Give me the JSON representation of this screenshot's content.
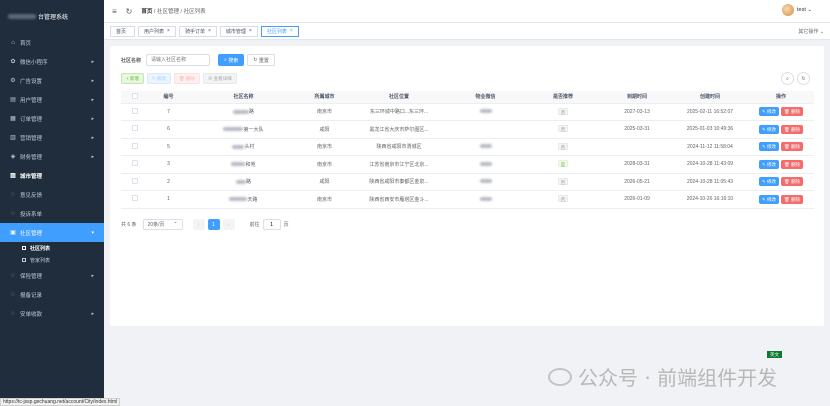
{
  "sidebar": {
    "logo_text": "台管理系统",
    "items": [
      {
        "icon": "⌂",
        "label": "首页",
        "arrow": ""
      },
      {
        "icon": "✿",
        "label": "微信小程序",
        "arrow": "▸"
      },
      {
        "icon": "⚙",
        "label": "广告设置",
        "arrow": "▸"
      },
      {
        "icon": "▤",
        "label": "用户管理",
        "arrow": "▸"
      },
      {
        "icon": "▦",
        "label": "订单管理",
        "arrow": "▸"
      },
      {
        "icon": "▥",
        "label": "营销管理",
        "arrow": "▸"
      },
      {
        "icon": "◈",
        "label": "财务管理",
        "arrow": "▸"
      },
      {
        "icon": "▨",
        "label": "城市管理",
        "arrow": ""
      },
      {
        "icon": "◌",
        "label": "意见反馈",
        "arrow": ""
      },
      {
        "icon": "◌",
        "label": "投诉系单",
        "arrow": ""
      },
      {
        "icon": "▣",
        "label": "社区管理",
        "arrow": "▾"
      },
      {
        "icon": "◌",
        "label": "保险管理",
        "arrow": "▸"
      },
      {
        "icon": "◌",
        "label": "报备记录",
        "arrow": ""
      },
      {
        "icon": "◌",
        "label": "安单收款",
        "arrow": "▸"
      }
    ],
    "sub_items": [
      {
        "label": "社区列表"
      },
      {
        "label": "管家列表"
      }
    ]
  },
  "navbar": {
    "crumbs": [
      "首页",
      "社区管理",
      "社区列表"
    ],
    "user_name": "test"
  },
  "tags": [
    {
      "label": "首页",
      "close": ""
    },
    {
      "label": "用户列表",
      "close": "×"
    },
    {
      "label": "骑手订单",
      "close": "×"
    },
    {
      "label": "城市管理",
      "close": "×"
    },
    {
      "label": "社区列表",
      "close": "×"
    }
  ],
  "other_ops": "其它操作 ⌄",
  "search": {
    "label": "社区名称",
    "placeholder": "请输入社区名称",
    "search_btn": "搜索",
    "reset_btn": "重置"
  },
  "toolbar": {
    "add": "+ 新增",
    "edit": "✎ 修改",
    "delete": "🗑 删除",
    "log": "⊕ 查看详细"
  },
  "table": {
    "headers": [
      "编号",
      "社区名称",
      "所属城市",
      "社区位置",
      "物业微信",
      "是否推荐",
      "到期时间",
      "创建时间",
      "操作"
    ],
    "rows": [
      {
        "id": "7",
        "name": "路",
        "city": "南京市",
        "location": "东三环城中路口...东三环...",
        "recommend": "否",
        "expire": "2027-03-13",
        "created": "2025-02-11 16:52:07"
      },
      {
        "id": "6",
        "name": "第一大队",
        "city": "咸阳",
        "location": "黑龙江省大庆市萨尔图区...",
        "recommend": "否",
        "expire": "2025-03-31",
        "created": "2025-01-03 10:49:36"
      },
      {
        "id": "5",
        "name": "头村",
        "city": "南京市",
        "location": "陕西省咸阳市渭城区",
        "recommend": "否",
        "expire": "",
        "created": "2024-11-12 11:58:04"
      },
      {
        "id": "3",
        "name": "和苑",
        "city": "南京市",
        "location": "江苏省南京市江宁区北京...",
        "recommend": "是",
        "expire": "2028-03-31",
        "created": "2024-10-28 11:43:09"
      },
      {
        "id": "2",
        "name": "路",
        "city": "咸阳",
        "location": "陕西省咸阳市秦都区金泉...",
        "recommend": "否",
        "expire": "2026-05-21",
        "created": "2024-10-28 11:05:43"
      },
      {
        "id": "1",
        "name": "天路",
        "city": "南京市",
        "location": "陕西省西安市雁塔区金斗...",
        "recommend": "否",
        "expire": "2026-01-09",
        "created": "2024-10-26 16:16:10"
      }
    ],
    "edit_label": "✎ 修改",
    "delete_label": "🗑 删除"
  },
  "pager": {
    "total": "共 6 条",
    "size": "20条/页",
    "prev": "‹",
    "page": "1",
    "next": "›",
    "goto_label": "前往",
    "goto_value": "1",
    "goto_unit": "页"
  },
  "status_url": "https://tc-jssp.gechuang.net/account/City/index.html",
  "lang_badge": "英文",
  "watermark": "公众号 · 前端组件开发"
}
